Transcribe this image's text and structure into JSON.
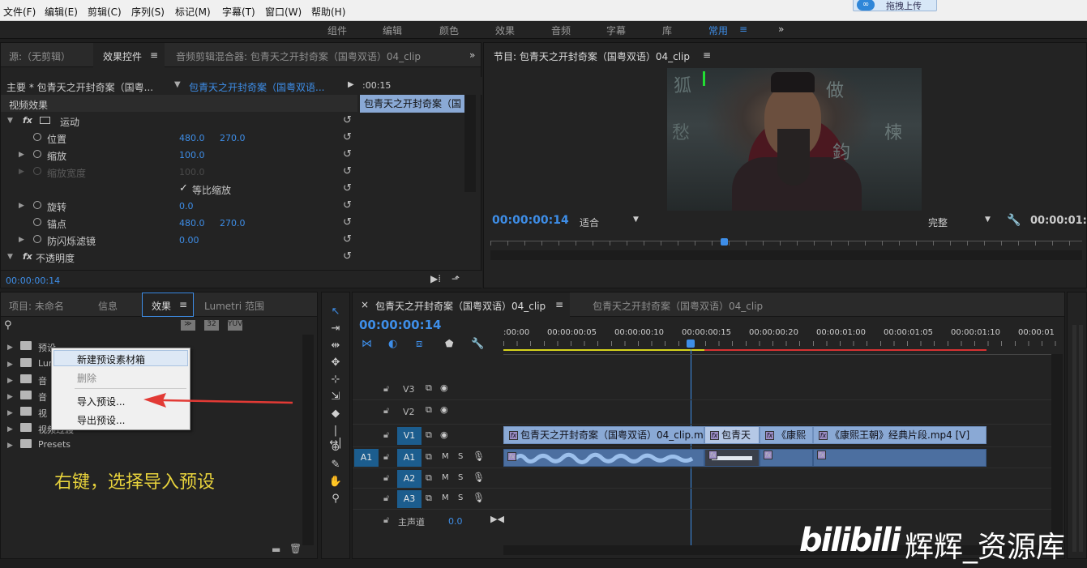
{
  "menu": [
    "文件(F)",
    "编辑(E)",
    "剪辑(C)",
    "序列(S)",
    "标记(M)",
    "字幕(T)",
    "窗口(W)",
    "帮助(H)"
  ],
  "upload_label": "拖拽上传",
  "workspaces": [
    "组件",
    "编辑",
    "颜色",
    "效果",
    "音频",
    "字幕",
    "库",
    "常用",
    "≡",
    "»"
  ],
  "source_tabs": {
    "source": "源:（无剪辑）",
    "effect_controls": "效果控件",
    "audio_mixer": "音频剪辑混合器: 包青天之开封奇案（国粤双语）04_clip",
    "menu": "≡",
    "more": "»"
  },
  "ec": {
    "master": "主要 * 包青天之开封奇案（国粤...",
    "seq": "包青天之开封奇案（国粤双语...",
    "time_ruler": ":00:15",
    "clip_bar": "包青天之开封奇案（国",
    "video_effects": "视频效果",
    "motion": "运动",
    "position": "位置",
    "pos_x": "480.0",
    "pos_y": "270.0",
    "scale": "缩放",
    "scale_v": "100.0",
    "scale_w": "缩放宽度",
    "scale_w_v": "100.0",
    "uniform": "等比缩放",
    "rotate": "旋转",
    "rotate_v": "0.0",
    "anchor": "锚点",
    "anc_x": "480.0",
    "anc_y": "270.0",
    "antiflicker": "防闪烁滤镜",
    "antiflicker_v": "0.00",
    "opacity": "不透明度",
    "timecode": "00:00:00:14"
  },
  "program": {
    "title": "节目: 包青天之开封奇案（国粤双语）04_clip",
    "menu": "≡",
    "timecode": "00:00:00:14",
    "fit": "适合",
    "quality": "完整",
    "duration": "00:00:01:1",
    "video_chars": [
      "狐",
      "做",
      "愁",
      "鈞",
      "楝"
    ]
  },
  "project_tabs": {
    "project": "项目: 未命名",
    "info": "信息",
    "effects": "效果",
    "menu": "≡",
    "lumetri": "Lumetri 范围"
  },
  "effects_list": [
    "预设",
    "Lum",
    "音",
    "音",
    "视",
    "视频过渡",
    "Presets"
  ],
  "context_menu": [
    "新建预设素材箱",
    "删除",
    "导入预设...",
    "导出预设..."
  ],
  "annotation": "右键，选择导入预设",
  "timeline": {
    "close": "×",
    "tab1": "包青天之开封奇案（国粤双语）04_clip",
    "tab1_menu": "≡",
    "tab2": "包青天之开封奇案（国粤双语）04_clip",
    "timecode": "00:00:00:14",
    "ruler": [
      ":00:00",
      "00:00:00:05",
      "00:00:00:10",
      "00:00:00:15",
      "00:00:00:20",
      "00:00:01:00",
      "00:00:01:05",
      "00:00:01:10",
      "00:00:01"
    ],
    "tracks_v": [
      "V3",
      "V2",
      "V1"
    ],
    "tracks_a": [
      "A1",
      "A2",
      "A3"
    ],
    "src_a1": "A1",
    "master": "主声道",
    "master_v": "0.0",
    "m_label": "M",
    "s_label": "S",
    "clips_v": [
      "包青天之开封奇案（国粤双语）04_clip.m",
      "包青天",
      "《康熙",
      "《康熙王朝》经典片段.mp4 [V]"
    ]
  },
  "watermark": {
    "brand": "bilibili",
    "text": "辉辉_资源库"
  },
  "colors": {
    "accent": "#3e8ee8",
    "clip_video": "#8aa9d5",
    "clip_audio": "#4c6fa0",
    "annotation": "#e7d23c",
    "arrow": "#e23a35"
  }
}
